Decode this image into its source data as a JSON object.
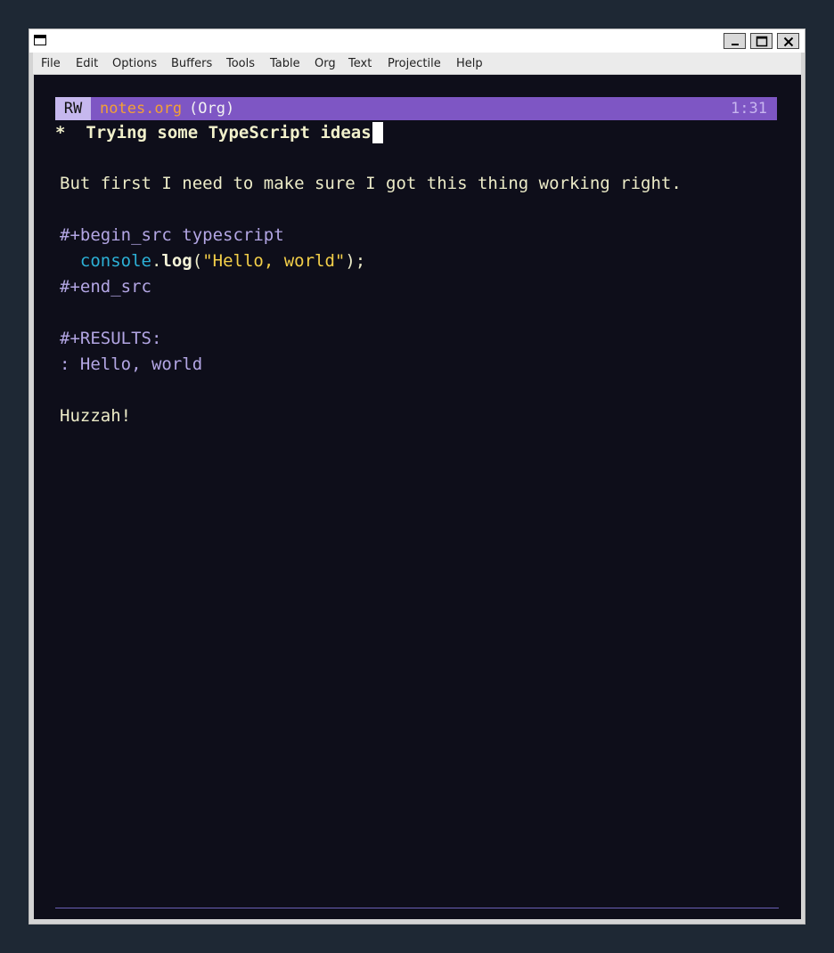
{
  "menu": [
    "File",
    "Edit",
    "Options",
    "Buffers",
    "Tools",
    "Table",
    "Org",
    "Text",
    "Projectile",
    "Help"
  ],
  "modeline": {
    "state": "RW",
    "filename": "notes.org",
    "mode": "(Org)",
    "position": "1:31"
  },
  "buffer": {
    "heading_star": "*",
    "heading_text": "Trying some TypeScript ideas",
    "paragraph": "But first I need to make sure I got this thing working right.",
    "begin_src": "#+begin_src typescript",
    "code_obj": "console",
    "code_dot": ".",
    "code_fn": "log",
    "code_open": "(",
    "code_str": "\"Hello, world\"",
    "code_close": ");",
    "end_src": "#+end_src",
    "results": "#+RESULTS:",
    "result_value": ": Hello, world",
    "closing": "Huzzah!"
  },
  "colors": {
    "editor_bg": "#0e0e1a",
    "modeline_bg": "#7e56c4",
    "filename": "#f4a134",
    "string": "#f3cf49",
    "object": "#2cb0d6",
    "meta": "#b3a6e4"
  }
}
